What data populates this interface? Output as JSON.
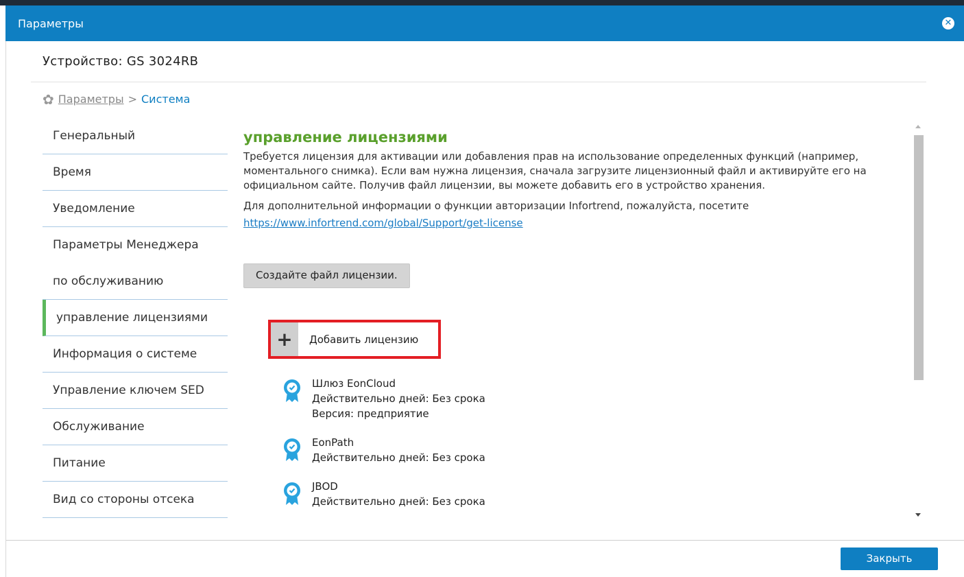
{
  "window": {
    "title": "Параметры",
    "close_icon": "close-circle-icon"
  },
  "device_label": "Устройство: GS 3024RB",
  "breadcrumb": {
    "icon": "gear-icon",
    "root": "Параметры",
    "separator": ">",
    "current": "Система"
  },
  "sidebar": {
    "items": [
      {
        "label": "Генеральный"
      },
      {
        "label": "Время"
      },
      {
        "label": "Уведомление"
      },
      {
        "label": "Параметры Менеджера"
      },
      {
        "label": "по обслуживанию"
      },
      {
        "label": "управление лицензиями",
        "active": true
      },
      {
        "label": "Информация о системе"
      },
      {
        "label": "Управление ключем SED"
      },
      {
        "label": "Обслуживание"
      },
      {
        "label": "Питание"
      },
      {
        "label": "Вид со стороны отсека"
      }
    ],
    "active_color": "#5cb85c"
  },
  "main": {
    "heading": "управление лицензиями",
    "description": "Требуется лицензия для активации или добавления прав на использование определенных функций (например, моментального снимка). Если вам нужна лицензия, сначала загрузите лицензионный файл и активируйте его на официальном сайте. Получив файл лицензии, вы можете добавить его в устройство хранения.",
    "more_info": "Для дополнительной информации о функции авторизации Infortrend, пожалуйста, посетите",
    "url": "https://www.infortrend.com/global/Support/get-license",
    "generate_button": "Создайте файл лицензии.",
    "add_button": "Добавить лицензию",
    "licenses": [
      {
        "icon": "license-badge-icon",
        "lines": [
          "Шлюз EonCloud",
          "Действительно дней: Без срока",
          "Версия: предприятие"
        ]
      },
      {
        "icon": "license-badge-icon",
        "lines": [
          "EonPath",
          "Действительно дней: Без срока"
        ]
      },
      {
        "icon": "license-badge-icon",
        "lines": [
          "JBOD",
          "Действительно дней: Без срока"
        ]
      }
    ]
  },
  "footer": {
    "close_button": "Закрыть"
  },
  "colors": {
    "titlebar": "#0f7fc2",
    "heading": "#5aa02c",
    "link": "#1a7cc4",
    "highlight_border": "#e31e24",
    "badge": "#29a3de"
  }
}
